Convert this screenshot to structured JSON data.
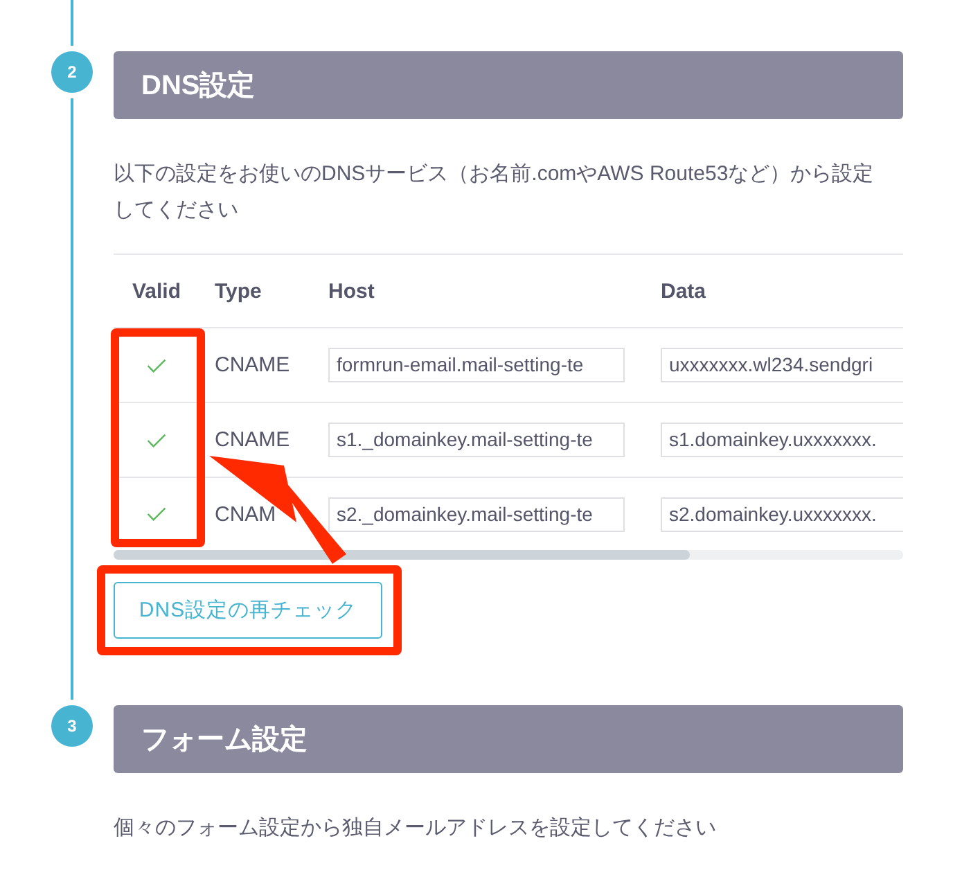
{
  "steps": [
    {
      "number": "2",
      "title": "DNS設定",
      "description": "以下の設定をお使いのDNSサービス（お名前.comやAWS Route53など）から設定してください",
      "records": {
        "columns": [
          "Valid",
          "Type",
          "Host",
          "Data"
        ],
        "annotation_frame": true,
        "annotation_arrow": true,
        "rows": [
          {
            "valid": true,
            "type": "CNAME",
            "host": "formrun-email.mail-setting-te",
            "data": "uxxxxxxx.wl234.sendgri"
          },
          {
            "valid": true,
            "type": "CNAME",
            "host": "s1._domainkey.mail-setting-te",
            "data": "s1.domainkey.uxxxxxxx."
          },
          {
            "valid": true,
            "type": "CNAM",
            "host": "s2._domainkey.mail-setting-te",
            "data": "s2.domainkey.uxxxxxxx."
          }
        ]
      },
      "button": {
        "label": "DNS設定の再チェック",
        "annotation_frame": true
      }
    },
    {
      "number": "3",
      "title": "フォーム設定",
      "description": "個々のフォーム設定から独自メールアドレスを設定してください"
    }
  ]
}
